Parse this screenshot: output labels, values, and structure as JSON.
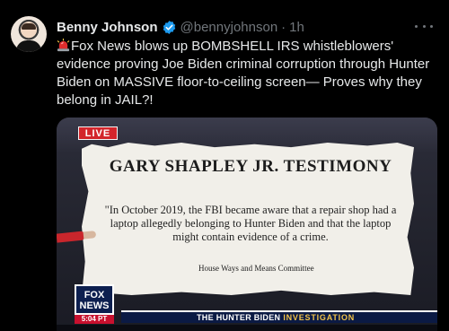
{
  "author": {
    "name": "Benny Johnson",
    "handle": "@bennyjohnson",
    "separator": "·",
    "time": "1h"
  },
  "tweet_text": "Fox News blows up BOMBSHELL IRS whistleblowers' evidence proving Joe Biden criminal corruption through Hunter Biden on MASSIVE floor-to-ceiling screen— Proves why they belong in JAIL?!",
  "media": {
    "live_badge": "LIVE",
    "paper_title": "GARY SHAPLEY JR. TESTIMONY",
    "quote": "\"In October 2019, the FBI became aware that a repair shop had a laptop allegedly belonging to Hunter Biden and that the laptop might contain evidence of a crime.",
    "source": "House Ways and Means Committee",
    "logo_line1": "FOX",
    "logo_line2": "NEWS",
    "clock": "5:04 PT",
    "chyron_main": "THE HUNTER BIDEN",
    "chyron_accent": "INVESTIGATION"
  },
  "colors": {
    "background": "#000000",
    "text": "#e7e9ea",
    "secondary_text": "#71767b",
    "verified_blue": "#1d9bf0",
    "live_red": "#d3252b",
    "fox_navy": "#0d1f4f"
  },
  "icons": [
    "verified-badge-icon",
    "siren-emoji-icon",
    "more-options-icon"
  ]
}
